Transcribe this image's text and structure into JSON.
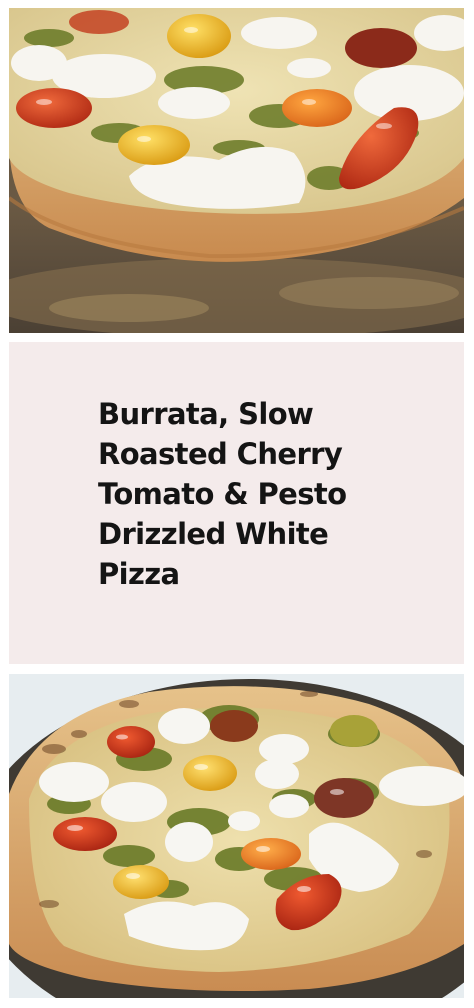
{
  "pin": {
    "title_lines": [
      "Burrata, Slow",
      "Roasted Cherry",
      "Tomato & Pesto",
      "Drizzled White",
      "Pizza"
    ]
  },
  "colors": {
    "card_background": "#f4ebeb",
    "title_text": "#141414",
    "crust": "#d9a96a",
    "burrata": "#f7f5f0",
    "pesto": "#7a8a32",
    "tomato_red": "#d2401f",
    "tomato_yellow": "#f0c022",
    "pizza_stone": "#3f3a33"
  },
  "images": {
    "top": "top-pizza-photo",
    "bottom": "bottom-pizza-photo"
  }
}
